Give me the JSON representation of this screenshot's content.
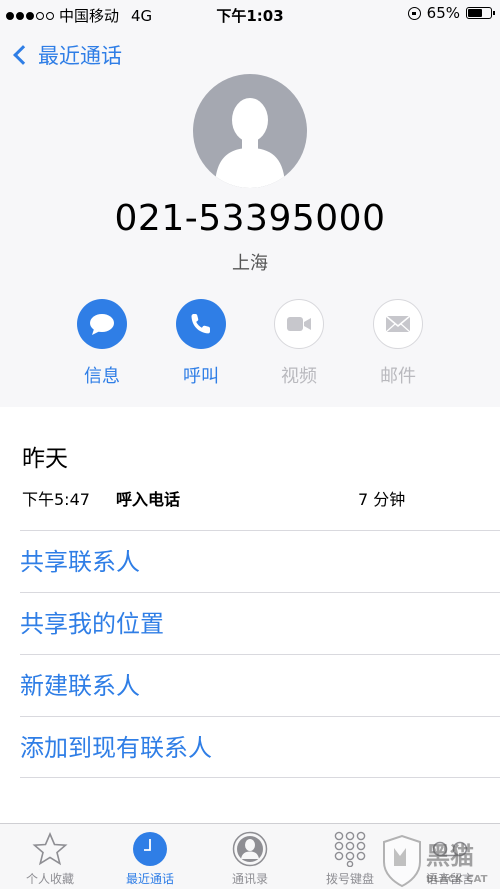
{
  "status_bar": {
    "carrier": "中国移动",
    "network": "4G",
    "time": "下午1:03",
    "battery": "65%",
    "battery_level": 0.65
  },
  "nav": {
    "back_label": "最近通话"
  },
  "contact": {
    "phone_number": "021-53395000",
    "location": "上海"
  },
  "actions": [
    {
      "label": "信息",
      "icon": "message-icon",
      "enabled": true
    },
    {
      "label": "呼叫",
      "icon": "phone-icon",
      "enabled": true
    },
    {
      "label": "视频",
      "icon": "video-icon",
      "enabled": false
    },
    {
      "label": "邮件",
      "icon": "mail-icon",
      "enabled": false
    }
  ],
  "call_history": {
    "date": "昨天",
    "entries": [
      {
        "time": "下午5:47",
        "type": "呼入电话",
        "duration": "7 分钟"
      }
    ]
  },
  "menu_items": [
    "共享联系人",
    "共享我的位置",
    "新建联系人",
    "添加到现有联系人"
  ],
  "tab_bar": [
    {
      "label": "个人收藏",
      "icon": "star-icon"
    },
    {
      "label": "最近通话",
      "icon": "clock-icon",
      "active": true
    },
    {
      "label": "通讯录",
      "icon": "contacts-icon"
    },
    {
      "label": "拨号键盘",
      "icon": "keypad-icon"
    },
    {
      "label": "语音留言",
      "icon": "voicemail-icon"
    }
  ],
  "watermark": {
    "text_cn": "黑猫",
    "text_en": "BLACK CAT"
  },
  "colors": {
    "accent": "#2f7ee6",
    "disabled": "#b9b9be",
    "avatar": "#a5a8b1"
  }
}
